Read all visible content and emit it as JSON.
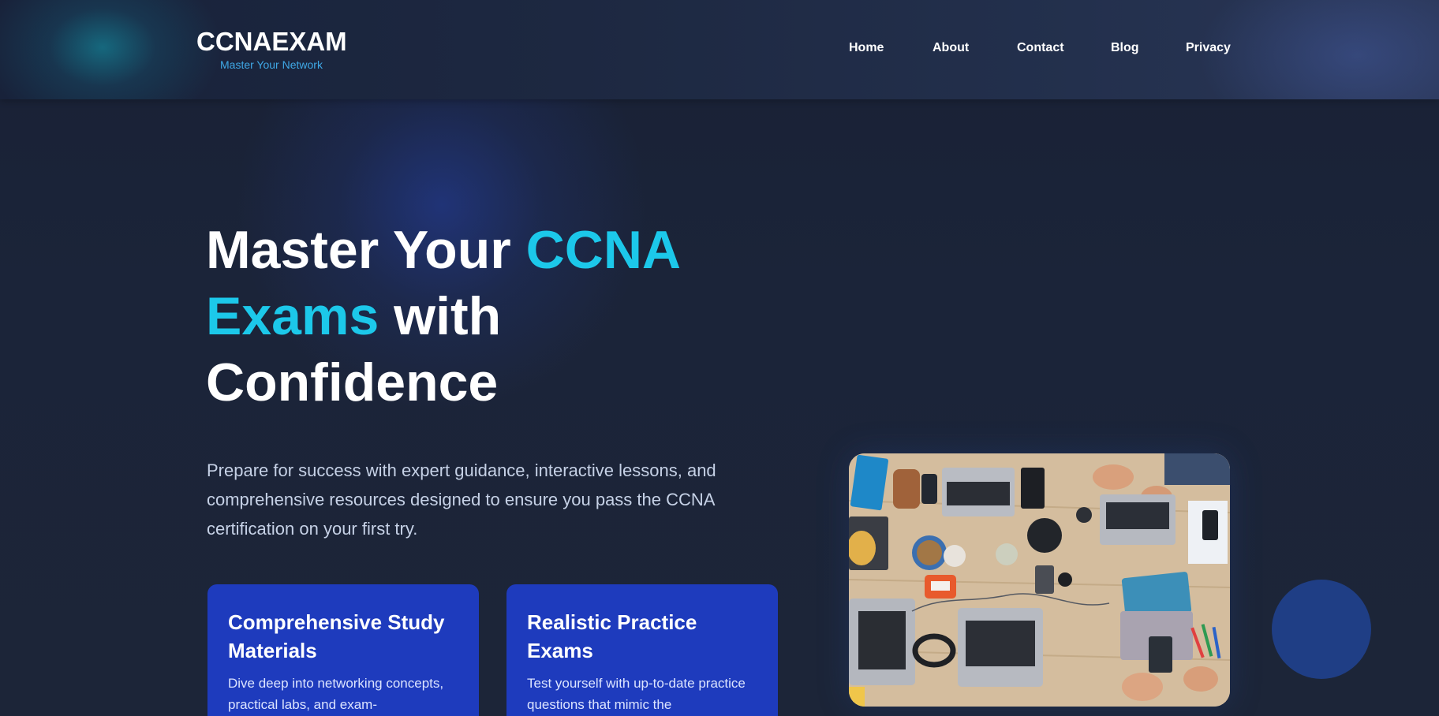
{
  "brand": {
    "title": "CCNAEXAM",
    "tagline": "Master Your Network"
  },
  "nav": {
    "items": [
      {
        "label": "Home"
      },
      {
        "label": "About"
      },
      {
        "label": "Contact"
      },
      {
        "label": "Blog"
      },
      {
        "label": "Privacy"
      }
    ]
  },
  "hero": {
    "title_part1": "Master Your ",
    "title_accent1": "CCNA",
    "title_accent2": "Exams",
    "title_part2": " with",
    "title_part3": "Confidence",
    "description": "Prepare for success with expert guidance, interactive lessons, and comprehensive resources designed to ensure you pass the CCNA certification on your first try.",
    "image_subject": "overhead photo of people working with laptops on a wooden table"
  },
  "cards": [
    {
      "title": "Comprehensive Study Materials",
      "text": "Dive deep into networking concepts, practical labs, and exam-"
    },
    {
      "title": "Realistic Practice Exams",
      "text": "Test yourself with up-to-date practice questions that mimic the"
    }
  ],
  "colors": {
    "accent": "#1cc8ea",
    "card_bg": "#1e3bbd",
    "tagline": "#3fa8e6",
    "background": "#1a2236"
  }
}
